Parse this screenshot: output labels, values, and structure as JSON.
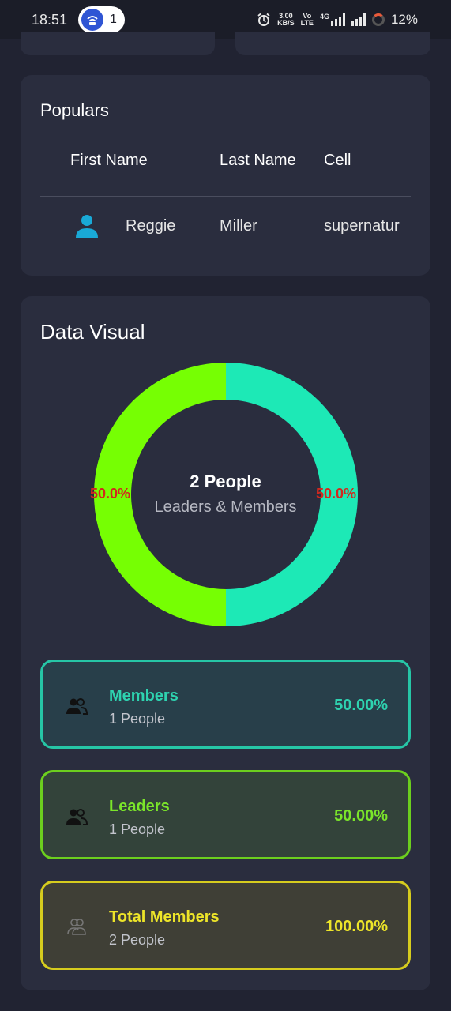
{
  "status_bar": {
    "time": "18:51",
    "hotspot_count": "1",
    "net_speed_value": "3.00",
    "net_speed_unit": "KB/S",
    "volte_top": "Vo",
    "volte_bottom": "LTE",
    "network_type": "4G",
    "battery": "12%"
  },
  "populars": {
    "title": "Populars",
    "columns": [
      "First Name",
      "Last Name",
      "Cell"
    ],
    "rows": [
      {
        "first_name": "Reggie",
        "last_name": "Miller",
        "cell": "supernatur"
      }
    ]
  },
  "data_visual": {
    "title": "Data Visual",
    "center_title": "2 People",
    "center_subtitle": "Leaders & Members",
    "chart_data": {
      "type": "pie",
      "categories": [
        "Members",
        "Leaders"
      ],
      "values": [
        50.0,
        50.0
      ],
      "labels": [
        "50.0%",
        "50.0%"
      ],
      "colors": [
        "#1de9b6",
        "#76ff03"
      ]
    }
  },
  "stats": [
    {
      "title": "Members",
      "subtitle": "1 People",
      "percent": "50.00%",
      "color": "#26c6a6",
      "icon": "group-icon"
    },
    {
      "title": "Leaders",
      "subtitle": "1 People",
      "percent": "50.00%",
      "color": "#7ed321",
      "icon": "group-icon"
    },
    {
      "title": "Total Members",
      "subtitle": "2 People",
      "percent": "100.00%",
      "color": "#e5e11c",
      "icon": "group-outline-icon"
    }
  ]
}
